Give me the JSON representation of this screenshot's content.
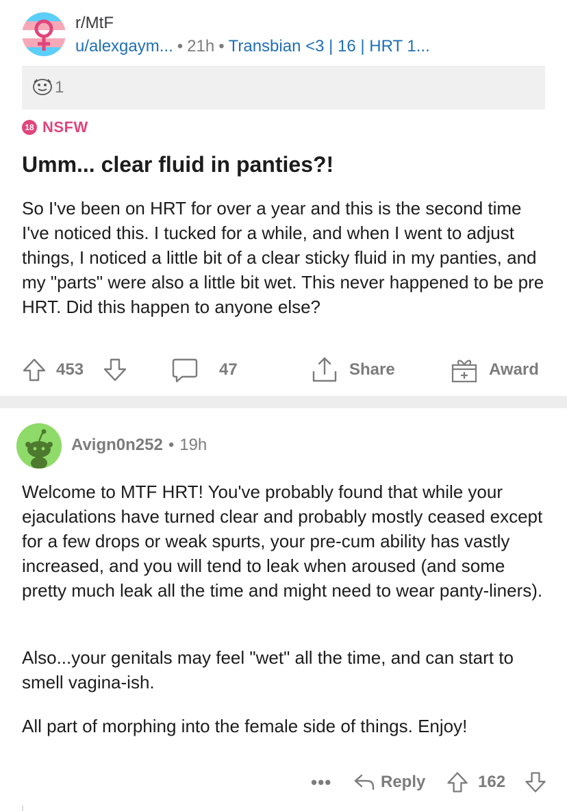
{
  "post": {
    "subreddit": "r/MtF",
    "author": "u/alexgaym...",
    "time": "21h",
    "flair": "Transbian <3 | 16 | HRT 1...",
    "award_count": "1",
    "nsfw_badge": "18",
    "nsfw_label": "NSFW",
    "title": "Umm... clear fluid in panties?!",
    "body": "So I've been on HRT for over a year and this is the second time I've noticed this. I tucked for a while, and when I went to adjust things, I noticed a little bit of a clear sticky fluid in my panties, and my \"parts\" were also a little bit wet. This never happened to be pre HRT. Did this happen to anyone else?",
    "upvotes": "453",
    "comments": "47",
    "share_label": "Share",
    "award_label": "Award"
  },
  "comment": {
    "username": "Avign0n252",
    "time": "19h",
    "paragraphs": [
      "Welcome to MTF HRT!  You've probably found that while your ejaculations have turned clear and probably mostly ceased except for a few drops or weak spurts, your pre-cum ability has vastly increased, and you will tend to leak when aroused (and some pretty much leak all the time and might need to wear panty-liners).",
      "Also...your genitals may feel \"wet\" all the time, and can start to smell vagina-ish.",
      "All part of morphing into the female side of things. Enjoy!"
    ],
    "more_label": "•••",
    "reply_label": "Reply",
    "upvotes": "162"
  },
  "colors": {
    "link": "#1f6fb5",
    "nsfw": "#e0457b",
    "muted": "#7c7c7c",
    "avatar_green": "#8fdb6a"
  }
}
